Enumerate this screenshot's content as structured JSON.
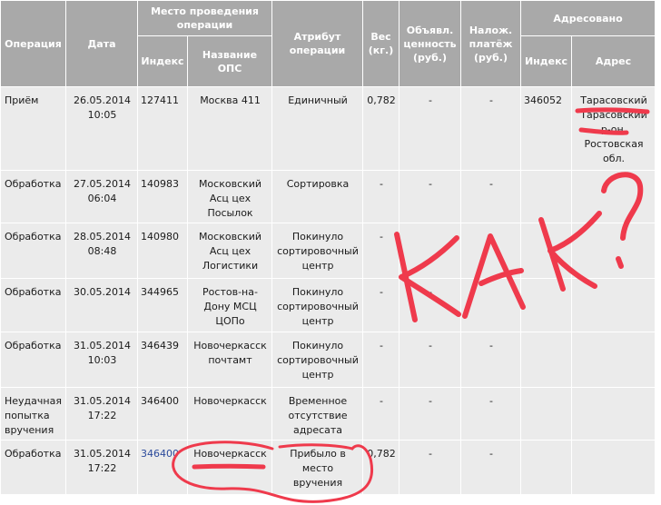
{
  "headers": {
    "operation": "Операция",
    "date": "Дата",
    "place": "Место проведения операции",
    "place_index": "Индекс",
    "place_name": "Название ОПС",
    "attribute": "Атрибут операции",
    "weight": "Вес (кг.)",
    "declared_value": "Объявл. ценность (руб.)",
    "cod": "Налож. платёж (руб.)",
    "addressed": "Адресовано",
    "addr_index": "Индекс",
    "addr_address": "Адрес"
  },
  "rows": [
    {
      "operation": "Приём",
      "date": "26.05.2014\n10:05",
      "index": "127411",
      "name": "Москва 411",
      "attribute": "Единичный",
      "weight": "0,782",
      "declared": "-",
      "cod": "-",
      "addr_index": "346052",
      "addr": "Тарасовский\nТарасовский\nр-он,\nРостовская\nобл."
    },
    {
      "operation": "Обработка",
      "date": "27.05.2014\n06:04",
      "index": "140983",
      "name": "Московский\nАсц цех\nПосылок",
      "attribute": "Сортировка",
      "weight": "-",
      "declared": "-",
      "cod": "-",
      "addr_index": "",
      "addr": ""
    },
    {
      "operation": "Обработка",
      "date": "28.05.2014\n08:48",
      "index": "140980",
      "name": "Московский\nАсц цех\nЛогистики",
      "attribute": "Покинуло\nсортировочный\nцентр",
      "weight": "-",
      "declared": "",
      "cod": "",
      "addr_index": "",
      "addr": ""
    },
    {
      "operation": "Обработка",
      "date": "30.05.2014",
      "index": "344965",
      "name": "Ростов-на-\nДону МСЦ\nЦОПо",
      "attribute": "Покинуло\nсортировочный\nцентр",
      "weight": "-",
      "declared": "-",
      "cod": "",
      "addr_index": "",
      "addr": ""
    },
    {
      "operation": "Обработка",
      "date": "31.05.2014\n10:03",
      "index": "346439",
      "name": "Новочеркасск\nпочтамт",
      "attribute": "Покинуло\nсортировочный\nцентр",
      "weight": "-",
      "declared": "-",
      "cod": "-",
      "addr_index": "",
      "addr": ""
    },
    {
      "operation": "Неудачная\nпопытка\nвручения",
      "date": "31.05.2014\n17:22",
      "index": "346400",
      "name": "Новочеркасск",
      "attribute": "Временное\nотсутствие\nадресата",
      "weight": "-",
      "declared": "-",
      "cod": "-",
      "addr_index": "",
      "addr": ""
    },
    {
      "operation": "Обработка",
      "date": "31.05.2014\n17:22",
      "index": "346400",
      "name": "Новочеркасск",
      "attribute": "Прибыло в\nместо\nвручения",
      "weight": "0,782",
      "declared": "-",
      "cod": "-",
      "addr_index": "",
      "addr": ""
    }
  ],
  "annotation": {
    "handwritten_text": "КАК?",
    "ink_color": "#ef3a4c"
  }
}
